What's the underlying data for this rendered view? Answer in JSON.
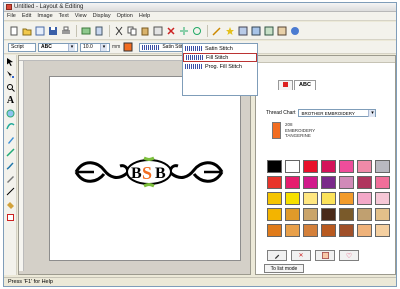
{
  "window": {
    "title": "Untitled - Layout & Editing"
  },
  "menu": [
    "File",
    "Edit",
    "Image",
    "Text",
    "View",
    "Display",
    "Option",
    "Help"
  ],
  "toolbar2": {
    "mode": "Script",
    "text_sample": "ABC",
    "size_value": "10.0",
    "unit": "mm",
    "stitch_type": "Satin Stitch"
  },
  "stitch_dropdown": {
    "options": [
      "Satin Stitch",
      "Fill Stitch",
      "Prog. Fill Stitch"
    ],
    "selected_index": 1
  },
  "panel": {
    "tabs": [
      "",
      "ABC"
    ],
    "thread_chart_label": "Thread Chart",
    "thread_chart_value": "BROTHER EMBROIDERY",
    "current_color": {
      "code": "208",
      "brand": "EMBROIDERY",
      "name": "TANGERINE",
      "hex": "#f26d21"
    },
    "palette": [
      "#000000",
      "#ffffff",
      "#e8102a",
      "#d4145a",
      "#ef4d9b",
      "#f08aa8",
      "#b8b8c0",
      "#e8342a",
      "#e61d6e",
      "#d11a8b",
      "#7a2a8a",
      "#d18ab8",
      "#b0355e",
      "#f16f9a",
      "#f5c400",
      "#f7e000",
      "#ffe680",
      "#fbe25a",
      "#f29b2b",
      "#f3a8c8",
      "#f6c7d6",
      "#f3b400",
      "#e09a2a",
      "#caa46a",
      "#4a2a1a",
      "#7a5a2a",
      "#c0a070",
      "#e3c08a",
      "#e07b1a",
      "#e8a04a",
      "#d4803a",
      "#b85a20",
      "#a0502a",
      "#efb27a",
      "#f4cfa0"
    ],
    "tobuild_label": "To list mode"
  },
  "status": {
    "text": "Press 'F1' for Help"
  }
}
